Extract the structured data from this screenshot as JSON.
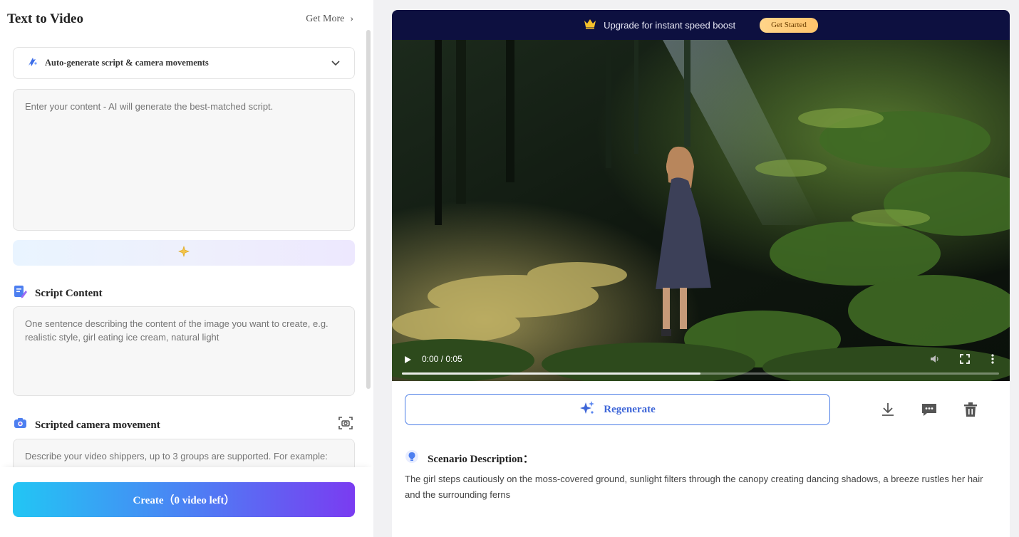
{
  "left_panel": {
    "title": "Text to Video",
    "get_more": "Get More",
    "auto_generate": {
      "label": "Auto-generate script & camera movements",
      "icon": "magic-wand-icon"
    },
    "content_input": {
      "placeholder": "Enter your content - AI will generate the best-matched script.",
      "value": ""
    },
    "generate_bar": {
      "icon": "sparkle-icon"
    },
    "script_section": {
      "title": "Script Content",
      "placeholder": "One sentence describing the content of the image you want to create, e.g. realistic style, girl eating ice cream, natural light",
      "value": ""
    },
    "camera_section": {
      "title": "Scripted camera movement",
      "placeholder": "Describe your video shippers, up to 3 groups are supported. For example:",
      "value": ""
    },
    "create_button": "Create（0 video left）"
  },
  "right_panel": {
    "banner": {
      "text": "Upgrade for instant speed boost",
      "button": "Get Started",
      "icon": "crown-icon"
    },
    "video": {
      "time": "0:00 / 0:05",
      "progress": 0.5
    },
    "regenerate": "Regenerate",
    "actions": [
      "download-icon",
      "comment-icon",
      "trash-icon"
    ],
    "scenario": {
      "title": "Scenario Description：",
      "text": "The girl steps cautiously on the moss-covered ground, sunlight filters through the canopy creating dancing shadows, a breeze rustles her hair and the surrounding ferns"
    }
  },
  "colors": {
    "accent": "#4a7de6",
    "banner_bg": "#0d1040",
    "create_gradient_start": "#22c6f4",
    "create_gradient_end": "#7a3cf1",
    "get_started_bg": "#ffc46b"
  }
}
